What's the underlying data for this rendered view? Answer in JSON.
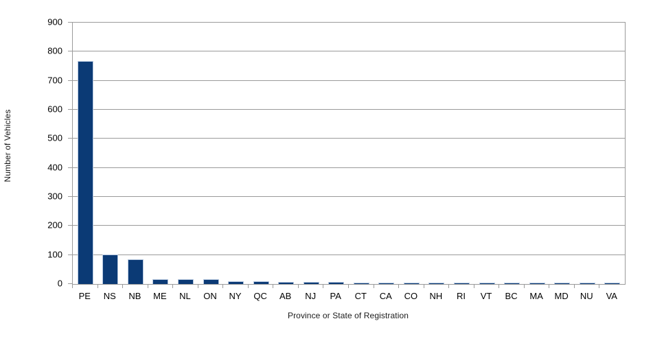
{
  "chart_data": {
    "type": "bar",
    "title": "",
    "xlabel": "Province or State of Registration",
    "ylabel": "Number of Vehicles",
    "categories": [
      "PE",
      "NS",
      "NB",
      "ME",
      "NL",
      "ON",
      "NY",
      "QC",
      "AB",
      "NJ",
      "PA",
      "CT",
      "CA",
      "CO",
      "NH",
      "RI",
      "VT",
      "BC",
      "MA",
      "MD",
      "NU",
      "VA"
    ],
    "values": [
      768,
      101,
      85,
      16,
      16,
      16,
      10,
      9,
      6,
      7,
      7,
      5,
      3,
      3,
      4,
      4,
      3,
      2,
      2,
      2,
      2,
      2
    ],
    "ylim": [
      0,
      900
    ],
    "ytick_labels": [
      "900",
      "800",
      "700",
      "600",
      "500",
      "400",
      "300",
      "200",
      "100",
      "0"
    ],
    "ytick_values": [
      900,
      800,
      700,
      600,
      500,
      400,
      300,
      200,
      100,
      0
    ],
    "grid": true,
    "legend": false,
    "legend_position": "none",
    "bar_color": "#0B3A75",
    "bar_border_color": "#b6c8e0",
    "grid_color": "#9a9a9a",
    "background_color": "#ffffff"
  }
}
